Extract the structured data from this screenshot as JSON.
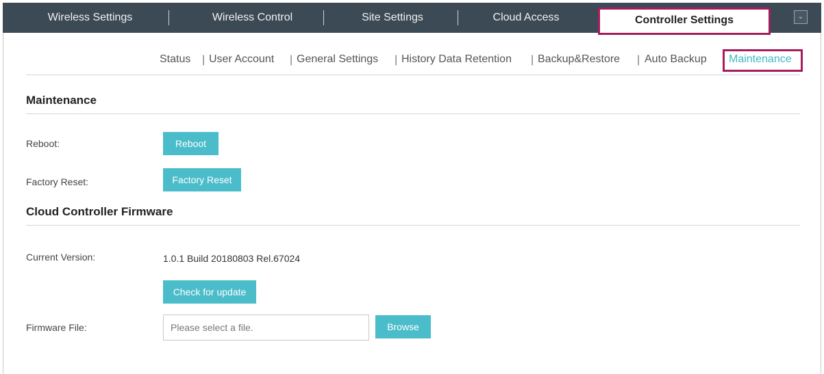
{
  "topnav": {
    "tabs": [
      {
        "label": "Wireless Settings"
      },
      {
        "label": "Wireless Control"
      },
      {
        "label": "Site Settings"
      },
      {
        "label": "Cloud Access"
      },
      {
        "label": "Controller Settings"
      }
    ],
    "active_tab": "Controller Settings",
    "dropdown_icon": "chevron-down-icon"
  },
  "subnav": {
    "items": [
      {
        "label": "Status"
      },
      {
        "label": "User Account"
      },
      {
        "label": "General Settings"
      },
      {
        "label": "History Data Retention"
      },
      {
        "label": "Backup&Restore"
      },
      {
        "label": "Auto Backup"
      },
      {
        "label": "Maintenance"
      }
    ],
    "active_item": "Maintenance"
  },
  "maintenance": {
    "title": "Maintenance",
    "reboot_label": "Reboot:",
    "reboot_button": "Reboot",
    "factory_reset_label": "Factory Reset:",
    "factory_reset_button": "Factory Reset"
  },
  "firmware": {
    "title": "Cloud Controller Firmware",
    "current_version_label": "Current Version:",
    "current_version_value": "1.0.1 Build 20180803 Rel.67024",
    "check_update_button": "Check for update",
    "firmware_file_label": "Firmware File:",
    "firmware_file_placeholder": "Please select a file.",
    "firmware_file_value": "",
    "browse_button": "Browse"
  },
  "colors": {
    "nav_background": "#3c4a56",
    "accent": "#4bbcc9",
    "highlight_border": "#a51c5c"
  }
}
